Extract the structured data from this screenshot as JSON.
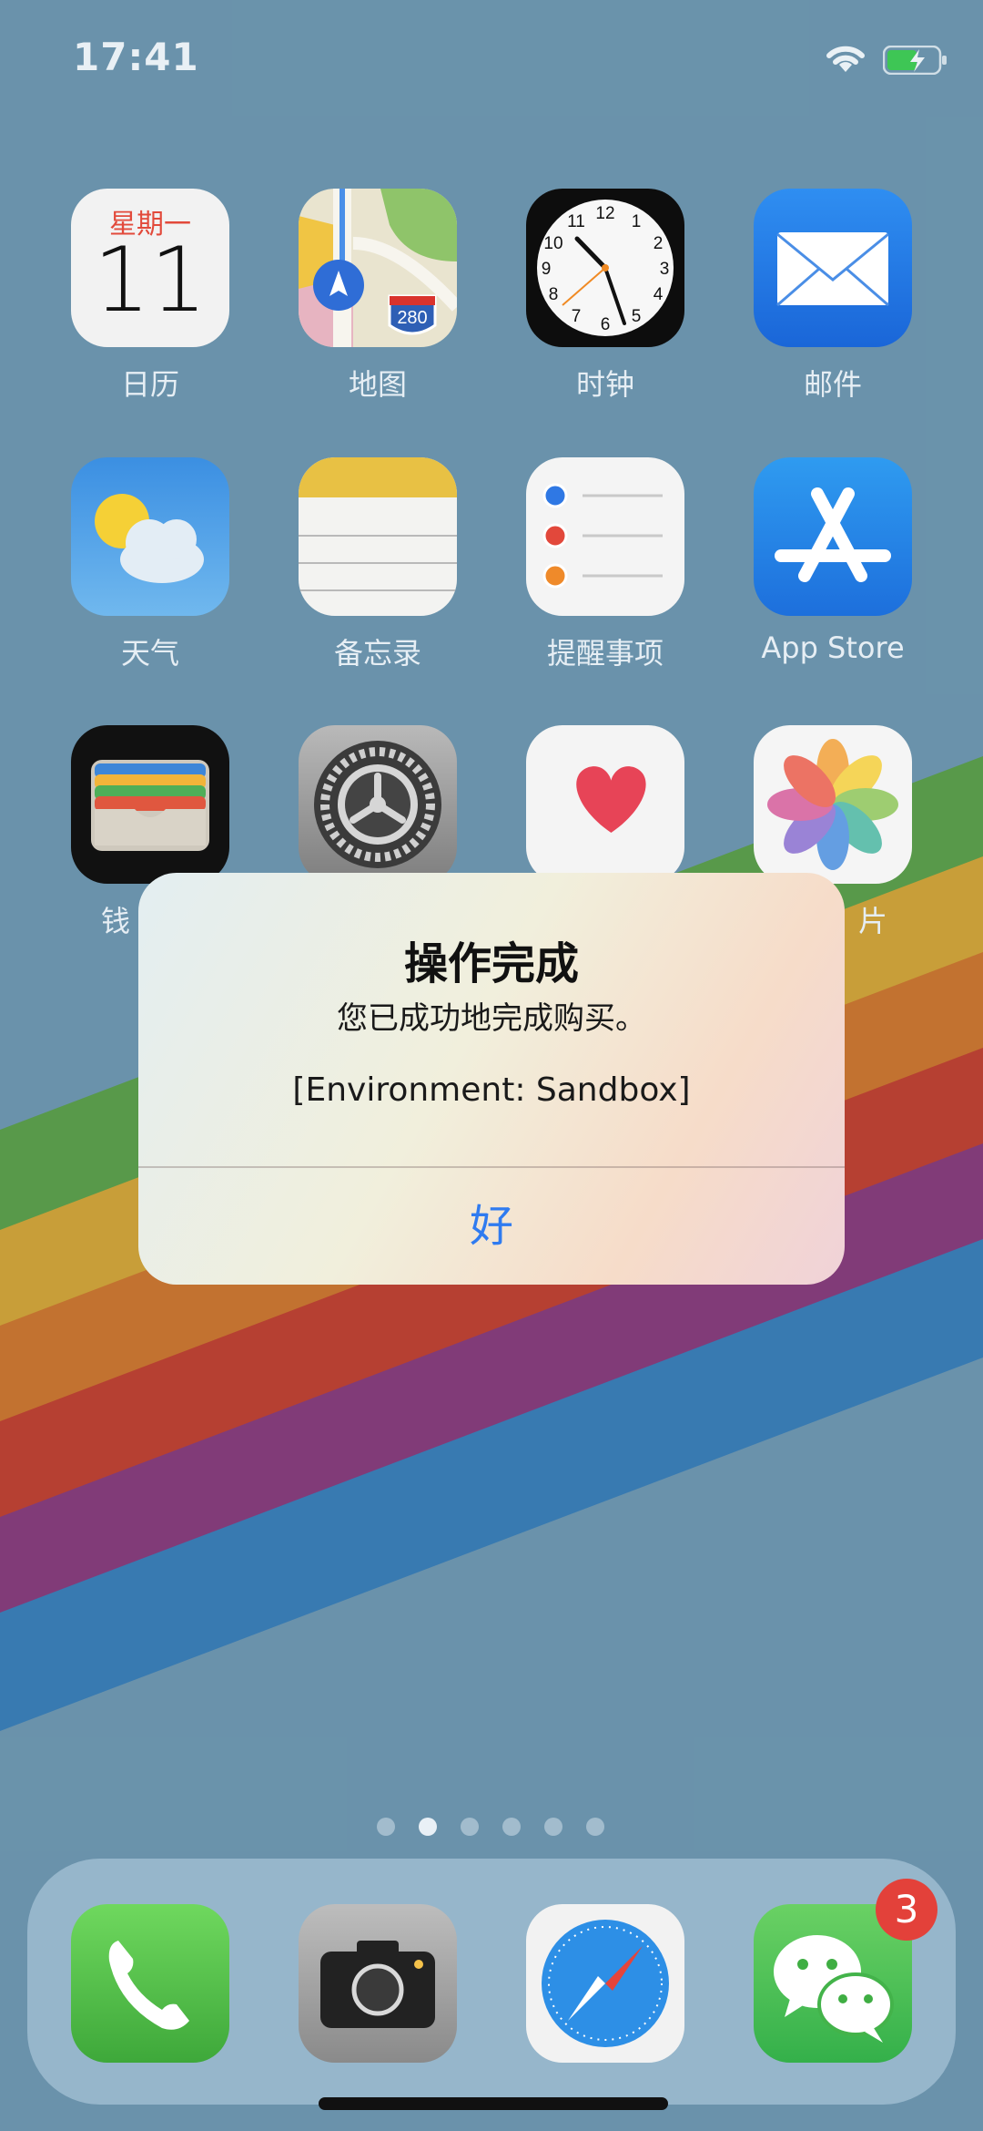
{
  "status_bar": {
    "time": "17:41"
  },
  "apps": [
    {
      "label": "日历",
      "icon": "calendar-icon",
      "weekday": "星期一",
      "day": "11"
    },
    {
      "label": "地图",
      "icon": "maps-icon",
      "route_sign": "280"
    },
    {
      "label": "时钟",
      "icon": "clock-icon"
    },
    {
      "label": "邮件",
      "icon": "mail-icon"
    },
    {
      "label": "天气",
      "icon": "weather-icon"
    },
    {
      "label": "备忘录",
      "icon": "notes-icon"
    },
    {
      "label": "提醒事项",
      "icon": "reminders-icon"
    },
    {
      "label": "App Store",
      "icon": "app-store-icon"
    },
    {
      "label": "钱",
      "icon": "wallet-icon"
    },
    {
      "label": "",
      "icon": "settings-icon"
    },
    {
      "label": "",
      "icon": "health-icon"
    },
    {
      "label": "片",
      "icon": "photos-icon"
    }
  ],
  "page_indicator": {
    "total": 6,
    "active": 2
  },
  "dock": [
    {
      "icon": "phone-icon"
    },
    {
      "icon": "camera-icon"
    },
    {
      "icon": "safari-icon"
    },
    {
      "icon": "wechat-icon",
      "badge": "3"
    }
  ],
  "alert": {
    "title": "操作完成",
    "message": "您已成功地完成购买。",
    "environment": "[Environment: Sandbox]",
    "button_label": "好"
  },
  "colors": {
    "wallpaper": "#719cb6",
    "alert_button": "#2f7bf0",
    "badge": "#e3413a"
  }
}
